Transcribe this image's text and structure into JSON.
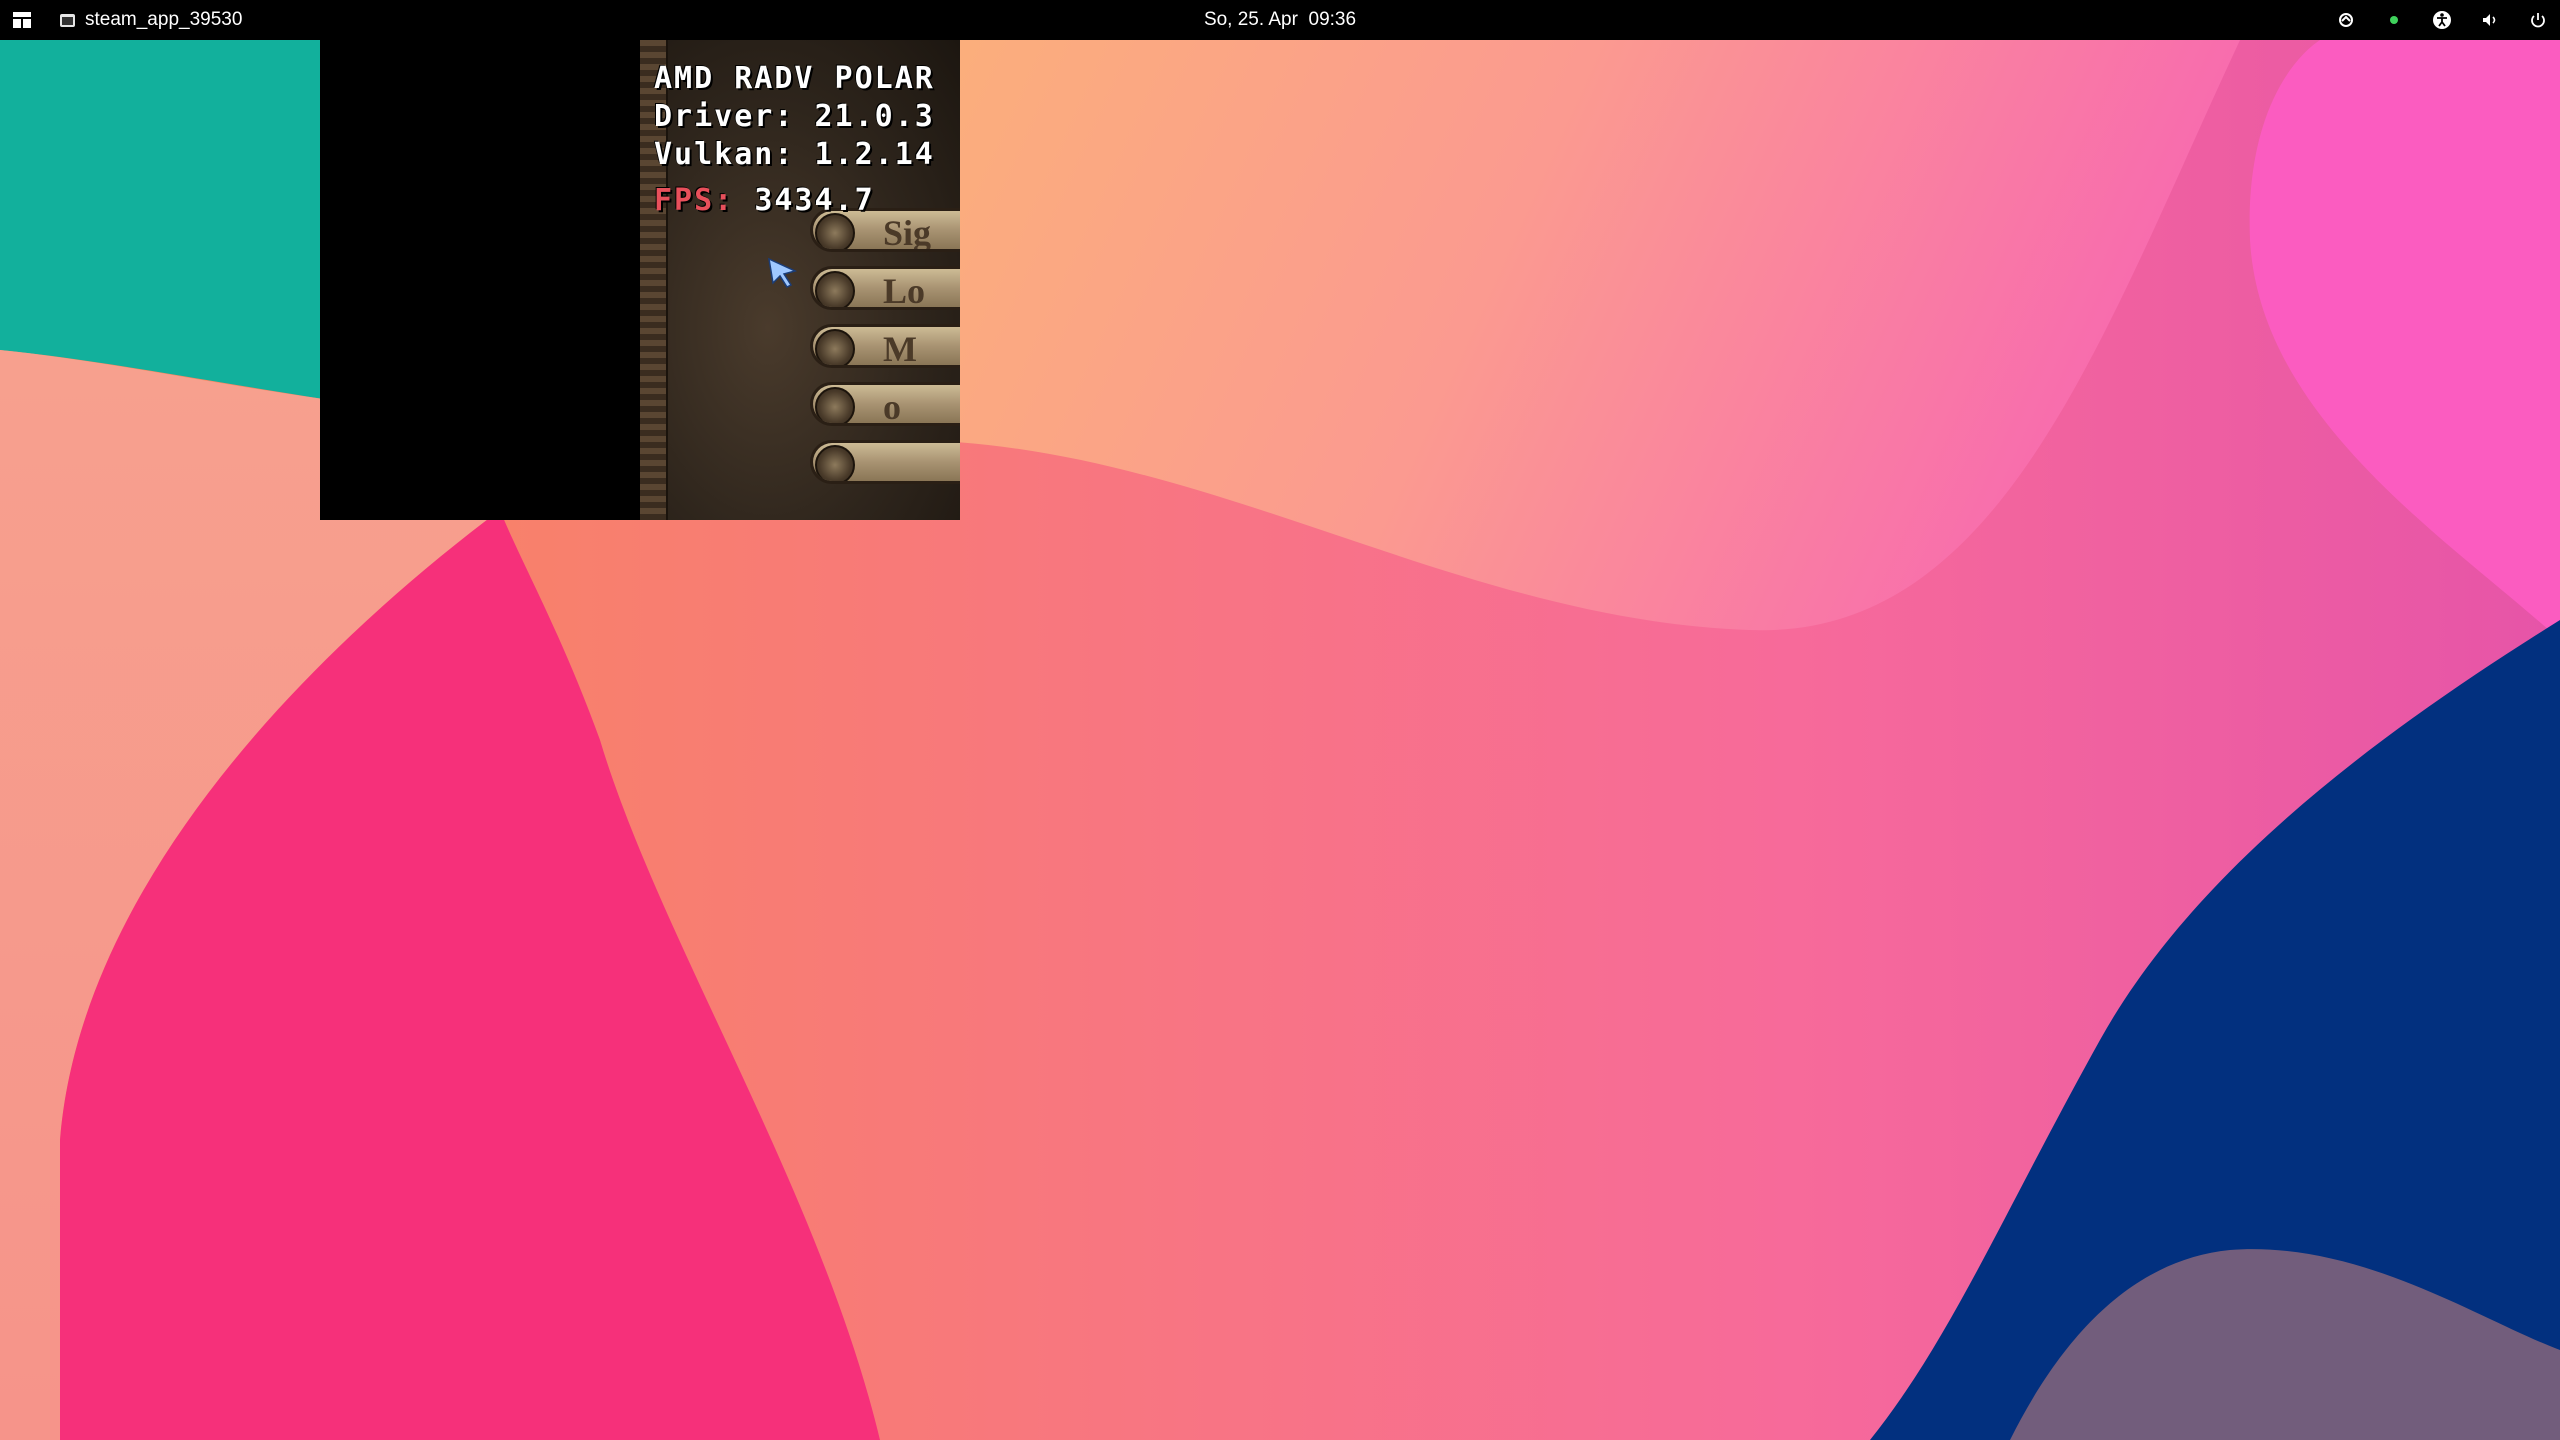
{
  "topbar": {
    "activities_icon": "activities-grid-icon",
    "app_name": "steam_app_39530",
    "clock": "So, 25. Apr  09:36",
    "tray": [
      "screencast-icon",
      "notification-dot-icon",
      "accessibility-icon",
      "volume-icon",
      "power-icon"
    ]
  },
  "game": {
    "hud": {
      "gpu": "AMD RADV POLAR",
      "driver": "Driver: 21.0.3",
      "vulkan": "Vulkan: 1.2.14",
      "fps_label": "FPS:",
      "fps_value": "3434.7"
    },
    "menu_buttons": [
      "Sig",
      "Lo",
      "M",
      "o",
      ""
    ]
  },
  "colors": {
    "teal": "#12b09c",
    "salmon": "#f69a8c",
    "magenta": "#f6307a",
    "orange": "#fbb07a",
    "pink": "#fb5fc0",
    "navy": "#02307f",
    "mauve": "#725d7c"
  }
}
